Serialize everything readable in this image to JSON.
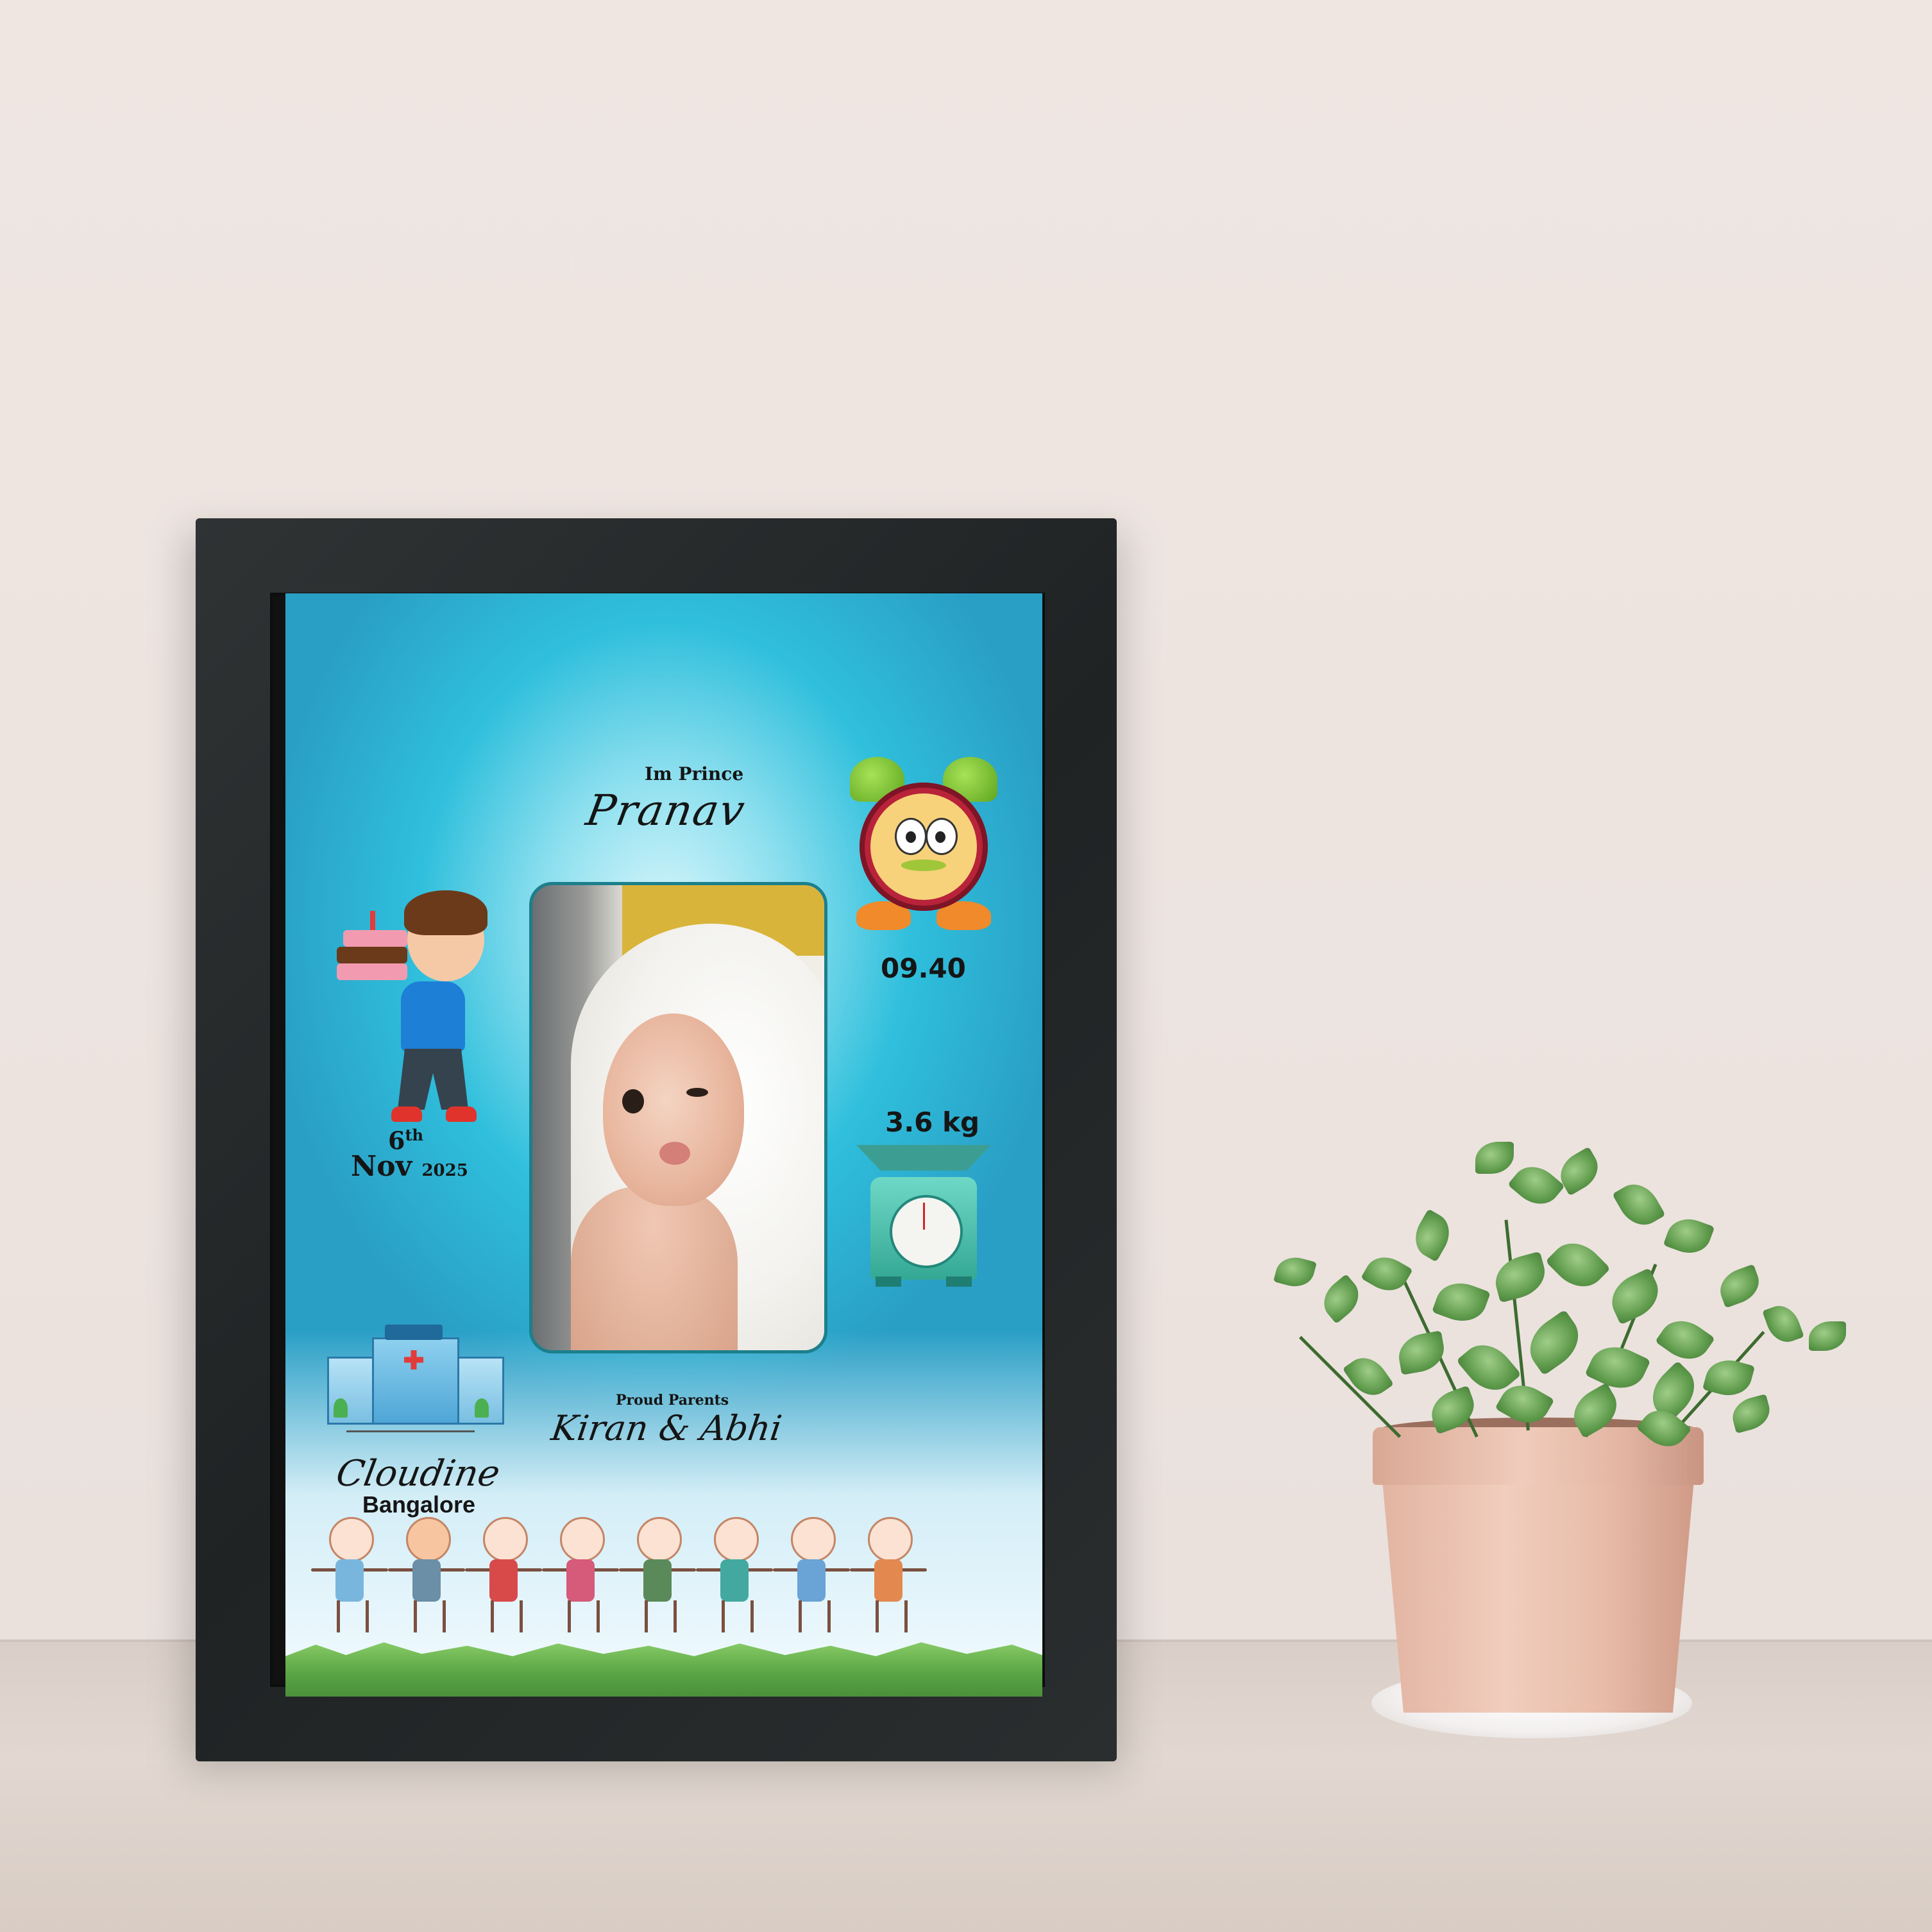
{
  "scene": {
    "description_colors": {
      "wall": "#ece3df",
      "table": "#dacfc8",
      "frame": "#242829",
      "print_background": "#2fbfdc"
    }
  },
  "poster": {
    "greeting": "Im Prince",
    "baby_name": "Pranav",
    "birth_time": "09.40",
    "weight": "3.6 kg",
    "birth_day": "6",
    "birth_day_suffix": "th",
    "birth_month": "Nov",
    "birth_year": "2025",
    "parents_label": "Proud Parents",
    "parents_names": "Kiran & Abhi",
    "hospital_name": "Cloudine",
    "city": "Bangalore"
  },
  "icons": {
    "clock": "alarm-clock-icon",
    "scale": "weighing-scale-icon",
    "boy": "boy-with-cake-icon",
    "hospital": "hospital-icon"
  }
}
